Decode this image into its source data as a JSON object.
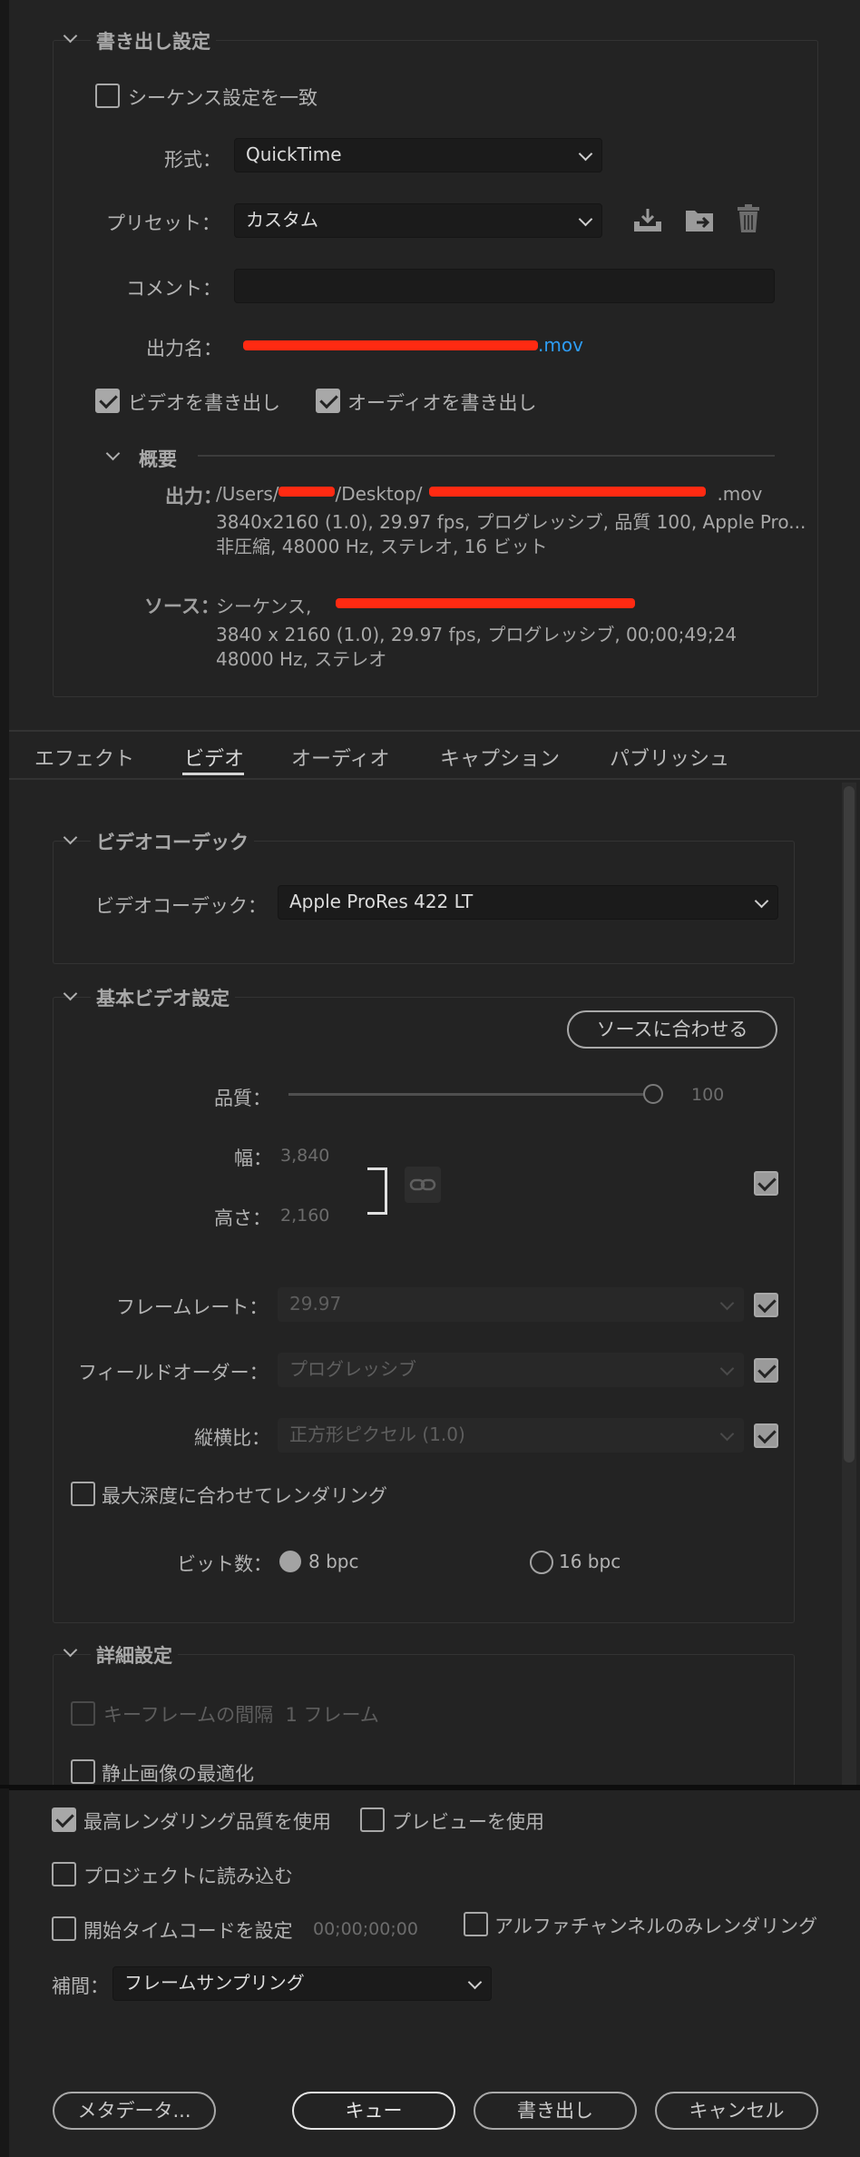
{
  "export_settings": {
    "title": "書き出し設定",
    "match_sequence_label": "シーケンス設定を一致",
    "format_label": "形式：",
    "format_value": "QuickTime",
    "preset_label": "プリセット：",
    "preset_value": "カスタム",
    "comment_label": "コメント：",
    "comment_value": "",
    "output_name_label": "出力名：",
    "output_name_value": ".mov",
    "export_video_label": "ビデオを書き出し",
    "export_audio_label": "オーディオを書き出し",
    "summary": {
      "title": "概要",
      "output_label": "出力：",
      "output_path_prefix": "/Users/",
      "output_path_mid": "/Desktop/",
      "output_path_suffix": ".mov",
      "output_line2": "3840x2160 (1.0), 29.97 fps, プログレッシブ, 品質 100, Apple Pro...",
      "output_line3": "非圧縮, 48000 Hz, ステレオ, 16 ビット",
      "source_label": "ソース：",
      "source_line1": "シーケンス,",
      "source_line2": "3840 x 2160 (1.0), 29.97 fps, プログレッシブ, 00;00;49;24",
      "source_line3": "48000 Hz, ステレオ"
    }
  },
  "tabs": [
    {
      "label": "エフェクト"
    },
    {
      "label": "ビデオ"
    },
    {
      "label": "オーディオ"
    },
    {
      "label": "キャプション"
    },
    {
      "label": "パブリッシュ"
    }
  ],
  "video_codec": {
    "title": "ビデオコーデック",
    "codec_label": "ビデオコーデック：",
    "codec_value": "Apple ProRes 422 LT"
  },
  "basic_video": {
    "title": "基本ビデオ設定",
    "match_source_button": "ソースに合わせる",
    "quality_label": "品質：",
    "quality_value": "100",
    "quality_fraction": 1.0,
    "width_label": "幅：",
    "width_value": "3,840",
    "height_label": "高さ：",
    "height_value": "2,160",
    "frame_rate_label": "フレームレート：",
    "frame_rate_value": "29.97",
    "field_order_label": "フィールドオーダー：",
    "field_order_value": "プログレッシブ",
    "aspect_label": "縦横比：",
    "aspect_value": "正方形ピクセル (1.0)",
    "max_depth_label": "最大深度に合わせてレンダリング",
    "bit_depth_label": "ビット数：",
    "bpc8_label": "8 bpc",
    "bpc16_label": "16 bpc"
  },
  "advanced": {
    "title": "詳細設定",
    "keyframe_label": "キーフレームの間隔",
    "keyframe_value": "1 フレーム",
    "optimize_stills_label": "静止画像の最適化"
  },
  "bottom": {
    "max_render_label": "最高レンダリング品質を使用",
    "use_preview_label": "プレビューを使用",
    "import_project_label": "プロジェクトに読み込む",
    "start_timecode_label": "開始タイムコードを設定",
    "start_timecode_value": "00;00;00;00",
    "alpha_only_label": "アルファチャンネルのみレンダリング",
    "interp_label": "補間：",
    "interp_value": "フレームサンプリング",
    "metadata_button": "メタデータ...",
    "queue_button": "キュー",
    "export_button": "書き出し",
    "cancel_button": "キャンセル"
  },
  "colors": {
    "background": "#232323",
    "link": "#2d9cf5",
    "redaction": "#ff2a12"
  }
}
